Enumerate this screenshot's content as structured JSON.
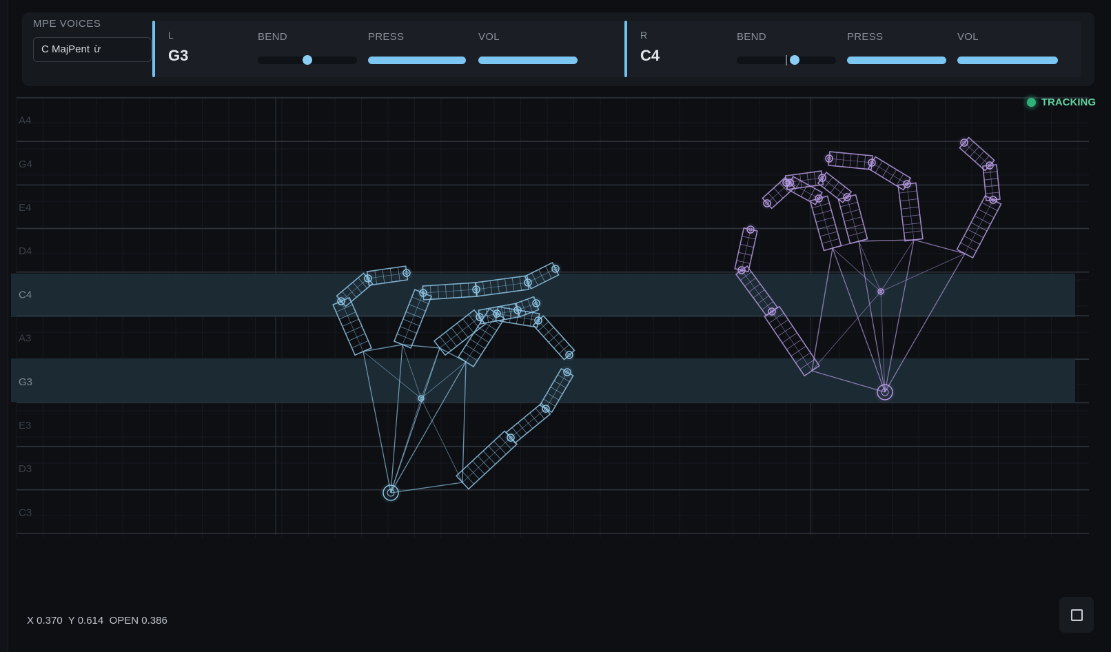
{
  "voices": {
    "label": "MPE VOICES",
    "selected_value": "C MajPent",
    "caret": "ừ"
  },
  "left_hand": {
    "letter": "L",
    "note": "G3",
    "bend_label": "BEND",
    "press_label": "PRESS",
    "vol_label": "VOL",
    "bend": 0.5,
    "press": 1.0,
    "vol": 1.0,
    "accent_color": "#6fc3f0"
  },
  "right_hand": {
    "letter": "R",
    "note": "C4",
    "bend_label": "BEND",
    "press_label": "PRESS",
    "vol_label": "VOL",
    "bend": 0.58,
    "press": 1.0,
    "vol": 1.0,
    "accent_color": "#6fc3f0"
  },
  "note_rows": [
    "A4",
    "G4",
    "E4",
    "D4",
    "C4",
    "A3",
    "G3",
    "E3",
    "D3",
    "C3"
  ],
  "active_notes": [
    "C4",
    "G3"
  ],
  "status": {
    "label": "TRACKING",
    "color": "#2fb27a"
  },
  "readout": {
    "x": "X 0.370",
    "y": "Y 0.614",
    "open": "OPEN 0.386"
  },
  "colors": {
    "left_hand_wire": "#8fc6e6",
    "right_hand_wire": "#b79be3",
    "highlight_row": "#1b2a33"
  },
  "icons": {
    "fullscreen": "square-icon",
    "status": "status-dot-icon"
  }
}
